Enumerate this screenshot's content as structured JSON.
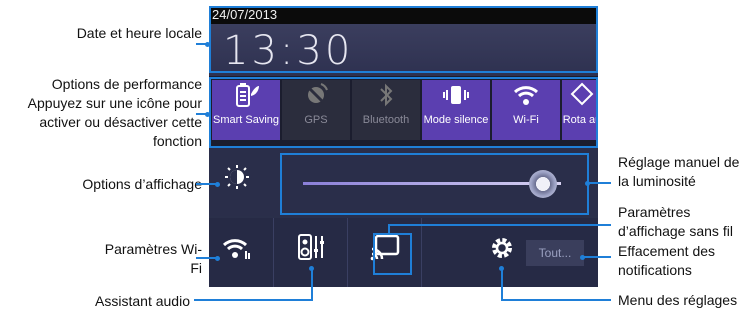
{
  "status": {
    "date": "24/07/2013"
  },
  "clock": {
    "time": "13:30"
  },
  "quick_settings": [
    {
      "label": "Smart Saving",
      "icon": "battery-leaf-icon",
      "state": "on"
    },
    {
      "label": "GPS",
      "icon": "gps-satellite-icon",
      "state": "off"
    },
    {
      "label": "Bluetooth",
      "icon": "bluetooth-icon",
      "state": "off"
    },
    {
      "label": "Mode silence",
      "icon": "speaker-vibrate-icon",
      "state": "on"
    },
    {
      "label": "Wi-Fi",
      "icon": "wifi-icon",
      "state": "on"
    },
    {
      "label": "Rota au",
      "icon": "rotate-icon",
      "state": "on"
    }
  ],
  "brightness": {
    "level": 0.93
  },
  "bottom": {
    "clear_label": "Tout..."
  },
  "annotations": {
    "date_time": "Date et heure locale",
    "performance": "Options de performance Appuyez sur une icône pour activer ou désactiver cette fonction",
    "display": "Options d’affichage",
    "wifi_settings": "Paramètres Wi-Fi",
    "audio": "Assistant audio",
    "brightness": "Réglage manuel de la luminosité",
    "wireless_display": "Paramètres d’affichage sans fil",
    "clear": "Effacement des notifications",
    "settings_menu": "Menu des réglages"
  },
  "colors": {
    "accent": "#1f7fd8",
    "tile_on": "#5b3fb0",
    "tile_off": "#2b2d3d"
  }
}
